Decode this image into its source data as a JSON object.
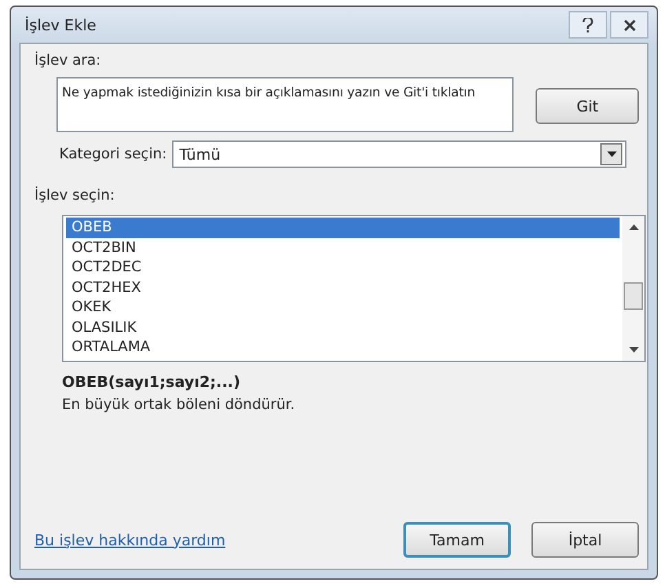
{
  "window": {
    "title": "İşlev Ekle"
  },
  "search": {
    "label": "İşlev ara:",
    "value": "Ne yapmak istediğinizin kısa bir açıklamasını yazın ve Git'i tıklatın",
    "button": "Git"
  },
  "category": {
    "label": "Kategori seçin:",
    "value": "Tümü"
  },
  "functions": {
    "label": "İşlev seçin:",
    "items": [
      {
        "name": "OBEB",
        "selected": true
      },
      {
        "name": "OCT2BIN",
        "selected": false
      },
      {
        "name": "OCT2DEC",
        "selected": false
      },
      {
        "name": "OCT2HEX",
        "selected": false
      },
      {
        "name": "OKEK",
        "selected": false
      },
      {
        "name": "OLASILIK",
        "selected": false
      },
      {
        "name": "ORTALAMA",
        "selected": false
      }
    ]
  },
  "signature": "OBEB(sayı1;sayı2;...)",
  "description": "En büyük ortak böleni döndürür.",
  "help_link": "Bu işlev hakkında yardım",
  "buttons": [
    {
      "label": "Tamam",
      "default": true
    },
    {
      "label": "İptal",
      "default": false
    }
  ]
}
